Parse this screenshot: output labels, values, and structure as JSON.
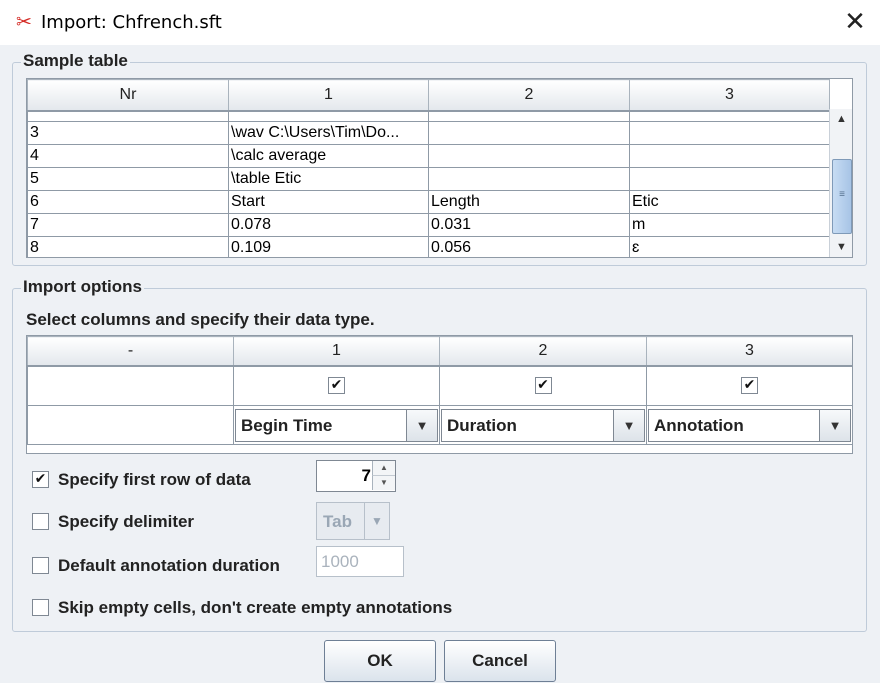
{
  "window": {
    "title": "Import: Chfrench.sft",
    "app_icon": "fork-app-icon",
    "close_icon": "✕"
  },
  "sample": {
    "group_title": "Sample table",
    "headers": [
      "Nr",
      "1",
      "2",
      "3"
    ],
    "rows": [
      [
        "3",
        "\\wav C:\\Users\\Tim\\Do...",
        "",
        ""
      ],
      [
        "4",
        "\\calc average",
        "",
        ""
      ],
      [
        "5",
        "\\table Etic",
        "",
        ""
      ],
      [
        "6",
        "Start",
        "Length",
        "Etic"
      ],
      [
        "7",
        "0.078",
        "0.031",
        "m"
      ],
      [
        "8",
        "0.109",
        "0.056",
        "ɛ"
      ]
    ]
  },
  "import_options": {
    "group_title": "Import options",
    "hint": "Select columns and specify their data type.",
    "headers": [
      "-",
      "1",
      "2",
      "3"
    ],
    "checks": [
      "✔",
      "✔",
      "✔"
    ],
    "types": [
      "Begin Time",
      "Duration",
      "Annotation"
    ],
    "first_row": {
      "label": "Specify first row of data",
      "checked": "✔",
      "value": "7"
    },
    "delimiter": {
      "label": "Specify delimiter",
      "value": "Tab"
    },
    "default_duration": {
      "label": "Default annotation duration",
      "value": "1000"
    },
    "skip_empty": {
      "label": "Skip empty cells, don't create empty annotations"
    }
  },
  "buttons": {
    "ok": "OK",
    "cancel": "Cancel"
  },
  "colors": {
    "accent": "#a7c4e6",
    "background": "#eef1f5",
    "icon_red": "#d42a24"
  }
}
